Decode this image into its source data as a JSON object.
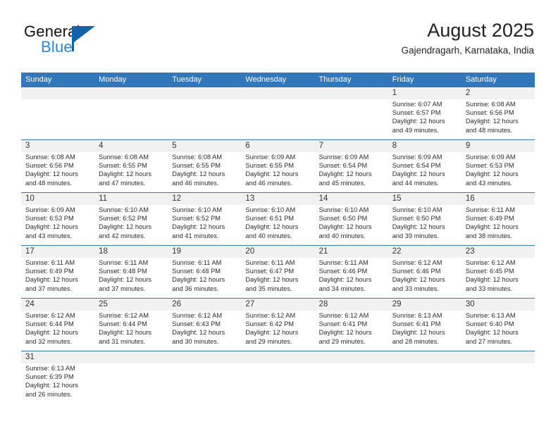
{
  "brand": {
    "name_top": "General",
    "name_bottom": "Blue",
    "flag_icon": "blue-flag-triangle-icon",
    "accent_color": "#2e86d6",
    "flag_color": "#1263a8"
  },
  "header": {
    "title": "August 2025",
    "subtitle": "Gajendragarh, Karnataka, India"
  },
  "calendar": {
    "header_color": "#3277b9",
    "band_color": "#f1f1f1",
    "weekdays": [
      "Sunday",
      "Monday",
      "Tuesday",
      "Wednesday",
      "Thursday",
      "Friday",
      "Saturday"
    ],
    "weeks": [
      [
        {
          "day": "",
          "sunrise": "",
          "sunset": "",
          "daylight_1": "",
          "daylight_2": ""
        },
        {
          "day": "",
          "sunrise": "",
          "sunset": "",
          "daylight_1": "",
          "daylight_2": ""
        },
        {
          "day": "",
          "sunrise": "",
          "sunset": "",
          "daylight_1": "",
          "daylight_2": ""
        },
        {
          "day": "",
          "sunrise": "",
          "sunset": "",
          "daylight_1": "",
          "daylight_2": ""
        },
        {
          "day": "",
          "sunrise": "",
          "sunset": "",
          "daylight_1": "",
          "daylight_2": ""
        },
        {
          "day": "1",
          "sunrise": "Sunrise: 6:07 AM",
          "sunset": "Sunset: 6:57 PM",
          "daylight_1": "Daylight: 12 hours",
          "daylight_2": "and 49 minutes."
        },
        {
          "day": "2",
          "sunrise": "Sunrise: 6:08 AM",
          "sunset": "Sunset: 6:56 PM",
          "daylight_1": "Daylight: 12 hours",
          "daylight_2": "and 48 minutes."
        }
      ],
      [
        {
          "day": "3",
          "sunrise": "Sunrise: 6:08 AM",
          "sunset": "Sunset: 6:56 PM",
          "daylight_1": "Daylight: 12 hours",
          "daylight_2": "and 48 minutes."
        },
        {
          "day": "4",
          "sunrise": "Sunrise: 6:08 AM",
          "sunset": "Sunset: 6:55 PM",
          "daylight_1": "Daylight: 12 hours",
          "daylight_2": "and 47 minutes."
        },
        {
          "day": "5",
          "sunrise": "Sunrise: 6:08 AM",
          "sunset": "Sunset: 6:55 PM",
          "daylight_1": "Daylight: 12 hours",
          "daylight_2": "and 46 minutes."
        },
        {
          "day": "6",
          "sunrise": "Sunrise: 6:09 AM",
          "sunset": "Sunset: 6:55 PM",
          "daylight_1": "Daylight: 12 hours",
          "daylight_2": "and 46 minutes."
        },
        {
          "day": "7",
          "sunrise": "Sunrise: 6:09 AM",
          "sunset": "Sunset: 6:54 PM",
          "daylight_1": "Daylight: 12 hours",
          "daylight_2": "and 45 minutes."
        },
        {
          "day": "8",
          "sunrise": "Sunrise: 6:09 AM",
          "sunset": "Sunset: 6:54 PM",
          "daylight_1": "Daylight: 12 hours",
          "daylight_2": "and 44 minutes."
        },
        {
          "day": "9",
          "sunrise": "Sunrise: 6:09 AM",
          "sunset": "Sunset: 6:53 PM",
          "daylight_1": "Daylight: 12 hours",
          "daylight_2": "and 43 minutes."
        }
      ],
      [
        {
          "day": "10",
          "sunrise": "Sunrise: 6:09 AM",
          "sunset": "Sunset: 6:53 PM",
          "daylight_1": "Daylight: 12 hours",
          "daylight_2": "and 43 minutes."
        },
        {
          "day": "11",
          "sunrise": "Sunrise: 6:10 AM",
          "sunset": "Sunset: 6:52 PM",
          "daylight_1": "Daylight: 12 hours",
          "daylight_2": "and 42 minutes."
        },
        {
          "day": "12",
          "sunrise": "Sunrise: 6:10 AM",
          "sunset": "Sunset: 6:52 PM",
          "daylight_1": "Daylight: 12 hours",
          "daylight_2": "and 41 minutes."
        },
        {
          "day": "13",
          "sunrise": "Sunrise: 6:10 AM",
          "sunset": "Sunset: 6:51 PM",
          "daylight_1": "Daylight: 12 hours",
          "daylight_2": "and 40 minutes."
        },
        {
          "day": "14",
          "sunrise": "Sunrise: 6:10 AM",
          "sunset": "Sunset: 6:50 PM",
          "daylight_1": "Daylight: 12 hours",
          "daylight_2": "and 40 minutes."
        },
        {
          "day": "15",
          "sunrise": "Sunrise: 6:10 AM",
          "sunset": "Sunset: 6:50 PM",
          "daylight_1": "Daylight: 12 hours",
          "daylight_2": "and 39 minutes."
        },
        {
          "day": "16",
          "sunrise": "Sunrise: 6:11 AM",
          "sunset": "Sunset: 6:49 PM",
          "daylight_1": "Daylight: 12 hours",
          "daylight_2": "and 38 minutes."
        }
      ],
      [
        {
          "day": "17",
          "sunrise": "Sunrise: 6:11 AM",
          "sunset": "Sunset: 6:49 PM",
          "daylight_1": "Daylight: 12 hours",
          "daylight_2": "and 37 minutes."
        },
        {
          "day": "18",
          "sunrise": "Sunrise: 6:11 AM",
          "sunset": "Sunset: 6:48 PM",
          "daylight_1": "Daylight: 12 hours",
          "daylight_2": "and 37 minutes."
        },
        {
          "day": "19",
          "sunrise": "Sunrise: 6:11 AM",
          "sunset": "Sunset: 6:48 PM",
          "daylight_1": "Daylight: 12 hours",
          "daylight_2": "and 36 minutes."
        },
        {
          "day": "20",
          "sunrise": "Sunrise: 6:11 AM",
          "sunset": "Sunset: 6:47 PM",
          "daylight_1": "Daylight: 12 hours",
          "daylight_2": "and 35 minutes."
        },
        {
          "day": "21",
          "sunrise": "Sunrise: 6:11 AM",
          "sunset": "Sunset: 6:46 PM",
          "daylight_1": "Daylight: 12 hours",
          "daylight_2": "and 34 minutes."
        },
        {
          "day": "22",
          "sunrise": "Sunrise: 6:12 AM",
          "sunset": "Sunset: 6:46 PM",
          "daylight_1": "Daylight: 12 hours",
          "daylight_2": "and 33 minutes."
        },
        {
          "day": "23",
          "sunrise": "Sunrise: 6:12 AM",
          "sunset": "Sunset: 6:45 PM",
          "daylight_1": "Daylight: 12 hours",
          "daylight_2": "and 33 minutes."
        }
      ],
      [
        {
          "day": "24",
          "sunrise": "Sunrise: 6:12 AM",
          "sunset": "Sunset: 6:44 PM",
          "daylight_1": "Daylight: 12 hours",
          "daylight_2": "and 32 minutes."
        },
        {
          "day": "25",
          "sunrise": "Sunrise: 6:12 AM",
          "sunset": "Sunset: 6:44 PM",
          "daylight_1": "Daylight: 12 hours",
          "daylight_2": "and 31 minutes."
        },
        {
          "day": "26",
          "sunrise": "Sunrise: 6:12 AM",
          "sunset": "Sunset: 6:43 PM",
          "daylight_1": "Daylight: 12 hours",
          "daylight_2": "and 30 minutes."
        },
        {
          "day": "27",
          "sunrise": "Sunrise: 6:12 AM",
          "sunset": "Sunset: 6:42 PM",
          "daylight_1": "Daylight: 12 hours",
          "daylight_2": "and 29 minutes."
        },
        {
          "day": "28",
          "sunrise": "Sunrise: 6:12 AM",
          "sunset": "Sunset: 6:41 PM",
          "daylight_1": "Daylight: 12 hours",
          "daylight_2": "and 29 minutes."
        },
        {
          "day": "29",
          "sunrise": "Sunrise: 6:13 AM",
          "sunset": "Sunset: 6:41 PM",
          "daylight_1": "Daylight: 12 hours",
          "daylight_2": "and 28 minutes."
        },
        {
          "day": "30",
          "sunrise": "Sunrise: 6:13 AM",
          "sunset": "Sunset: 6:40 PM",
          "daylight_1": "Daylight: 12 hours",
          "daylight_2": "and 27 minutes."
        }
      ],
      [
        {
          "day": "31",
          "sunrise": "Sunrise: 6:13 AM",
          "sunset": "Sunset: 6:39 PM",
          "daylight_1": "Daylight: 12 hours",
          "daylight_2": "and 26 minutes."
        },
        {
          "day": "",
          "sunrise": "",
          "sunset": "",
          "daylight_1": "",
          "daylight_2": ""
        },
        {
          "day": "",
          "sunrise": "",
          "sunset": "",
          "daylight_1": "",
          "daylight_2": ""
        },
        {
          "day": "",
          "sunrise": "",
          "sunset": "",
          "daylight_1": "",
          "daylight_2": ""
        },
        {
          "day": "",
          "sunrise": "",
          "sunset": "",
          "daylight_1": "",
          "daylight_2": ""
        },
        {
          "day": "",
          "sunrise": "",
          "sunset": "",
          "daylight_1": "",
          "daylight_2": ""
        },
        {
          "day": "",
          "sunrise": "",
          "sunset": "",
          "daylight_1": "",
          "daylight_2": ""
        }
      ]
    ]
  }
}
